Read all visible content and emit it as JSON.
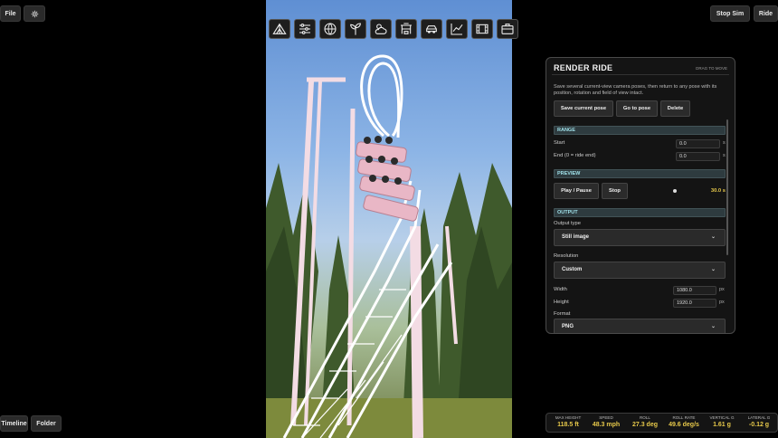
{
  "topbar": {
    "file_label": "File",
    "settings_icon": "gear-icon",
    "stop_sim_label": "Stop Sim",
    "ride_label": "Ride"
  },
  "toolbar": {
    "tools": [
      {
        "icon": "tent-icon"
      },
      {
        "icon": "sliders-icon"
      },
      {
        "icon": "globe-icon"
      },
      {
        "icon": "sprout-icon"
      },
      {
        "icon": "weather-icon"
      },
      {
        "icon": "station-icon"
      },
      {
        "icon": "car-icon"
      },
      {
        "icon": "chart-icon"
      },
      {
        "icon": "film-icon"
      },
      {
        "icon": "briefcase-icon"
      }
    ]
  },
  "panel": {
    "title": "RENDER RIDE",
    "drag_hint": "DRAG TO MOVE",
    "description": "Save several current-view camera poses, then return to any pose with its position, rotation and field of view intact.",
    "save_pose": "Save current pose",
    "goto_pose": "Go to pose",
    "delete": "Delete",
    "range": {
      "header": "RANGE",
      "start_label": "Start",
      "start_value": "0.0",
      "end_label": "End (0 = ride end)",
      "end_value": "0.0",
      "unit": "s"
    },
    "preview": {
      "header": "PREVIEW",
      "play_pause": "Play / Pause",
      "stop": "Stop",
      "time": "30.0 s"
    },
    "output": {
      "header": "OUTPUT",
      "type_label": "Output type",
      "type_value": "Still image",
      "resolution_label": "Resolution",
      "resolution_value": "Custom",
      "width_label": "Width",
      "width_value": "1080.0",
      "height_label": "Height",
      "height_value": "1920.0",
      "px_unit": "px",
      "format_label": "Format",
      "format_value": "PNG"
    }
  },
  "stats": [
    {
      "label": "MAX HEIGHT",
      "value": "118.5 ft"
    },
    {
      "label": "SPEED",
      "value": "48.3 mph"
    },
    {
      "label": "ROLL",
      "value": "27.3 deg"
    },
    {
      "label": "ROLL RATE",
      "value": "49.6 deg/s"
    },
    {
      "label": "VERTICAL G",
      "value": "1.61 g"
    },
    {
      "label": "LATERAL G",
      "value": "-0.12 g"
    }
  ],
  "bottombar": {
    "timeline_label": "Timeline",
    "folder_label": "Folder"
  },
  "colors": {
    "accent_value": "#e6c84a",
    "section_text": "#9fe0e8",
    "track_pink": "#e9b7c6"
  }
}
